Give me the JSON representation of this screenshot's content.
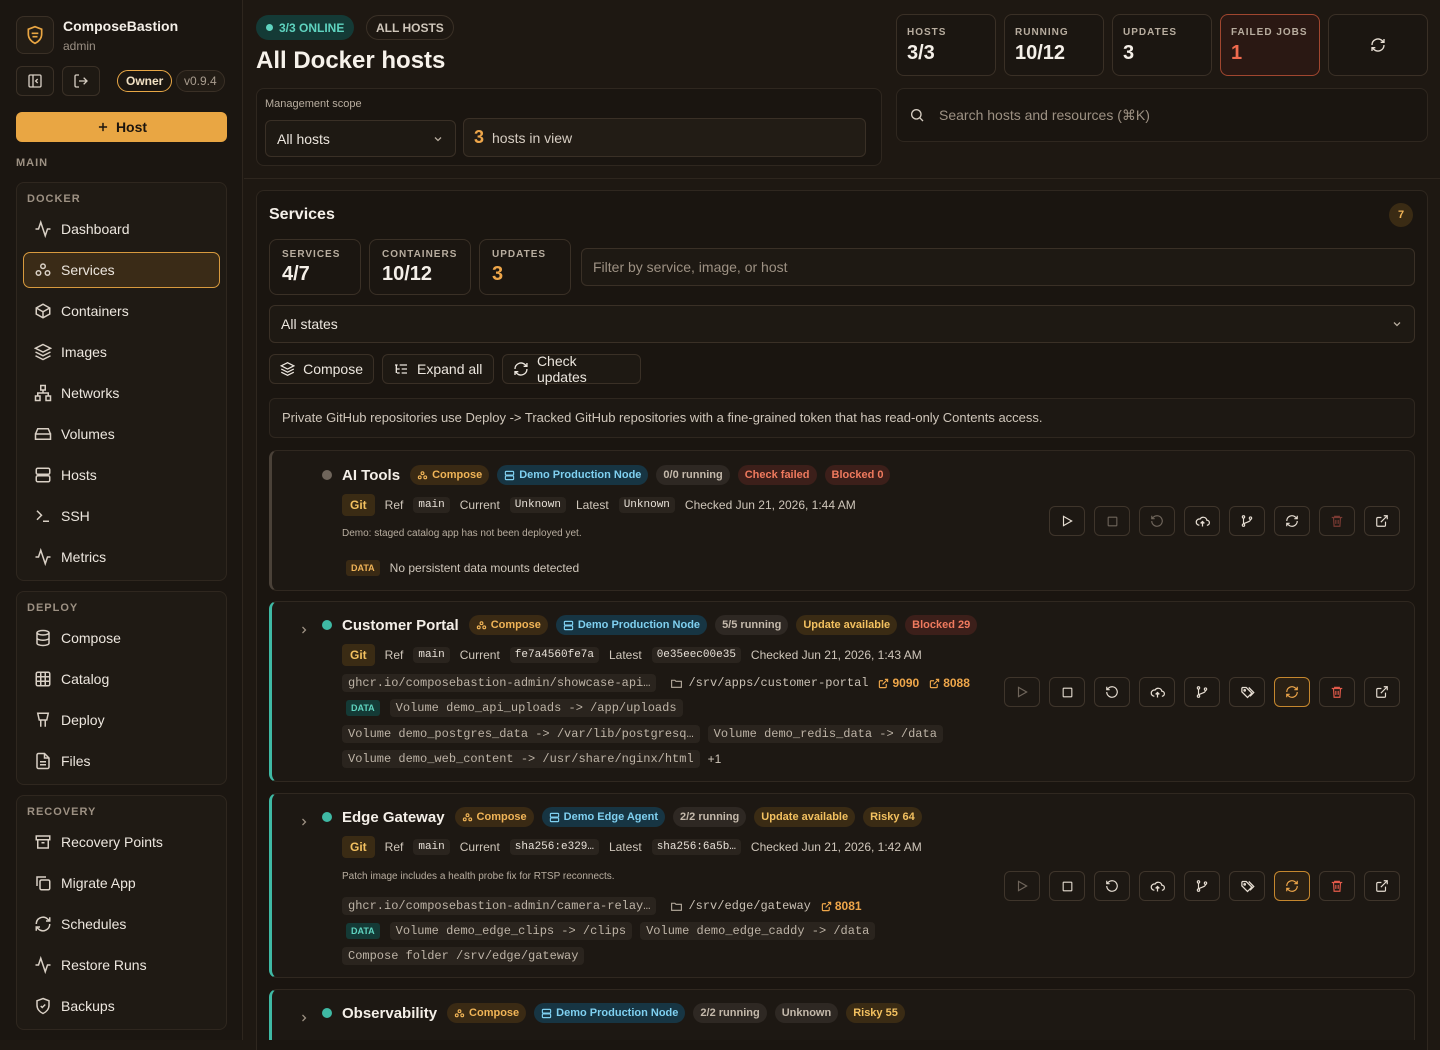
{
  "brand": {
    "name": "ComposeBastion",
    "user": "admin",
    "role": "Owner",
    "version": "v0.9.4"
  },
  "add_host_label": "Host",
  "main_section": "MAIN",
  "nav": {
    "docker": {
      "title": "DOCKER",
      "items": [
        {
          "label": "Dashboard",
          "icon": "activity-icon"
        },
        {
          "label": "Services",
          "icon": "services-icon",
          "active": true
        },
        {
          "label": "Containers",
          "icon": "box-icon"
        },
        {
          "label": "Images",
          "icon": "layers-icon"
        },
        {
          "label": "Networks",
          "icon": "network-icon"
        },
        {
          "label": "Volumes",
          "icon": "drive-icon"
        },
        {
          "label": "Hosts",
          "icon": "server-icon"
        },
        {
          "label": "SSH",
          "icon": "terminal-icon"
        },
        {
          "label": "Metrics",
          "icon": "activity-icon"
        }
      ]
    },
    "deploy": {
      "title": "DEPLOY",
      "items": [
        {
          "label": "Compose",
          "icon": "database-icon"
        },
        {
          "label": "Catalog",
          "icon": "grid-icon"
        },
        {
          "label": "Deploy",
          "icon": "deploy-icon"
        },
        {
          "label": "Files",
          "icon": "file-icon"
        }
      ]
    },
    "recovery": {
      "title": "RECOVERY",
      "items": [
        {
          "label": "Recovery Points",
          "icon": "archive-icon"
        },
        {
          "label": "Migrate App",
          "icon": "copy-icon"
        },
        {
          "label": "Schedules",
          "icon": "refresh-icon"
        },
        {
          "label": "Restore Runs",
          "icon": "activity-icon"
        },
        {
          "label": "Backups",
          "icon": "shield-icon"
        }
      ]
    }
  },
  "header": {
    "online_pill": "3/3 ONLINE",
    "scope_pill": "ALL HOSTS",
    "title": "All Docker hosts",
    "scope_label": "Management scope",
    "scope_select": "All hosts",
    "hosts_in_view_count": "3",
    "hosts_in_view_label": "hosts in view",
    "search_placeholder": "Search hosts and resources (⌘K)"
  },
  "stats": [
    {
      "label": "HOSTS",
      "value": "3/3"
    },
    {
      "label": "RUNNING",
      "value": "10/12"
    },
    {
      "label": "UPDATES",
      "value": "3"
    },
    {
      "label": "FAILED JOBS",
      "value": "1"
    }
  ],
  "services_panel": {
    "title": "Services",
    "count": "7",
    "stats": [
      {
        "label": "SERVICES",
        "value": "4/7"
      },
      {
        "label": "CONTAINERS",
        "value": "10/12"
      },
      {
        "label": "UPDATES",
        "value": "3"
      }
    ],
    "filter_placeholder": "Filter by service, image, or host",
    "state_select": "All states",
    "buttons": {
      "compose": "Compose",
      "expand": "Expand all",
      "check": "Check updates"
    },
    "notice": "Private GitHub repositories use Deploy -> Tracked GitHub repositories with a fine-grained token that has read-only Contents access."
  },
  "common": {
    "git": "Git",
    "ref": "Ref",
    "current": "Current",
    "latest": "Latest",
    "data": "DATA",
    "compose": "Compose"
  },
  "services": [
    {
      "name": "AI Tools",
      "node": "Demo Production Node",
      "running": "0/0 running",
      "status": "Check failed",
      "risk": "Blocked 0",
      "ref": "main",
      "current": "Unknown",
      "latest": "Unknown",
      "checked": "Checked Jun 21, 2026, 1:44 AM",
      "note": "Demo: staged catalog app has not been deployed yet.",
      "data_note": "No persistent data mounts detected"
    },
    {
      "name": "Customer Portal",
      "node": "Demo Production Node",
      "running": "5/5 running",
      "status": "Update available",
      "risk": "Blocked 29",
      "ref": "main",
      "current": "fe7a4560fe7a",
      "latest": "0e35eec00e35",
      "checked": "Checked Jun 21, 2026, 1:43 AM",
      "image": "ghcr.io/composebastion-admin/showcase-api…",
      "path": "/srv/apps/customer-portal",
      "ports": [
        "9090",
        "8088"
      ],
      "mounts": [
        "Volume demo_api_uploads -> /app/uploads",
        "Volume demo_postgres_data -> /var/lib/postgresq…",
        "Volume demo_redis_data -> /data",
        "Volume demo_web_content -> /usr/share/nginx/html"
      ],
      "more": "+1"
    },
    {
      "name": "Edge Gateway",
      "node": "Demo Edge Agent",
      "running": "2/2 running",
      "status": "Update available",
      "risk": "Risky 64",
      "ref": "main",
      "current": "sha256:e329…",
      "latest": "sha256:6a5b…",
      "checked": "Checked Jun 21, 2026, 1:42 AM",
      "note": "Patch image includes a health probe fix for RTSP reconnects.",
      "image": "ghcr.io/composebastion-admin/camera-relay…",
      "path": "/srv/edge/gateway",
      "ports": [
        "8081"
      ],
      "mounts": [
        "Volume demo_edge_clips -> /clips",
        "Volume demo_edge_caddy -> /data",
        "Compose folder /srv/edge/gateway"
      ]
    },
    {
      "name": "Observability",
      "node": "Demo Production Node",
      "running": "2/2 running",
      "status": "Unknown",
      "risk": "Risky 55"
    }
  ]
}
